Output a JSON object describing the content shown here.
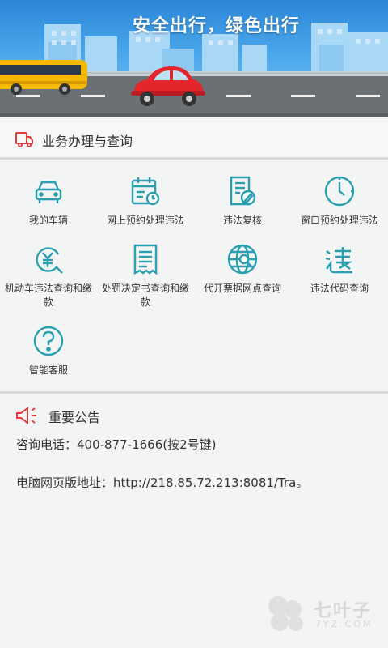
{
  "banner": {
    "slogan": "安全出行，绿色出行"
  },
  "business": {
    "title": "业务办理与查询",
    "items": [
      {
        "label": "我的车辆",
        "icon": "car-icon"
      },
      {
        "label": "网上预约处理违法",
        "icon": "calendar-clock-icon"
      },
      {
        "label": "违法复核",
        "icon": "document-pen-icon"
      },
      {
        "label": "窗口预约处理违法",
        "icon": "clock-icon"
      },
      {
        "label": "机动车违法查询和缴款",
        "icon": "yuan-search-icon"
      },
      {
        "label": "处罚决定书查询和缴款",
        "icon": "receipt-icon"
      },
      {
        "label": "代开票据网点查询",
        "icon": "globe-search-icon"
      },
      {
        "label": "违法代码查询",
        "icon": "violation-code-icon"
      },
      {
        "label": "智能客服",
        "icon": "question-icon"
      }
    ]
  },
  "announcement": {
    "title": "重要公告",
    "phone_line": "咨询电话：400-877-1666(按2号键)",
    "web_line": "电脑网页版地址：http://218.85.72.213:8081/Tra。"
  },
  "watermark": {
    "text": "七叶子",
    "sub": "7YZ.COM"
  },
  "colors": {
    "accent": "#2a9fb0",
    "header_icon": "#e23b3b",
    "banner_sky": "#3c9be3"
  }
}
